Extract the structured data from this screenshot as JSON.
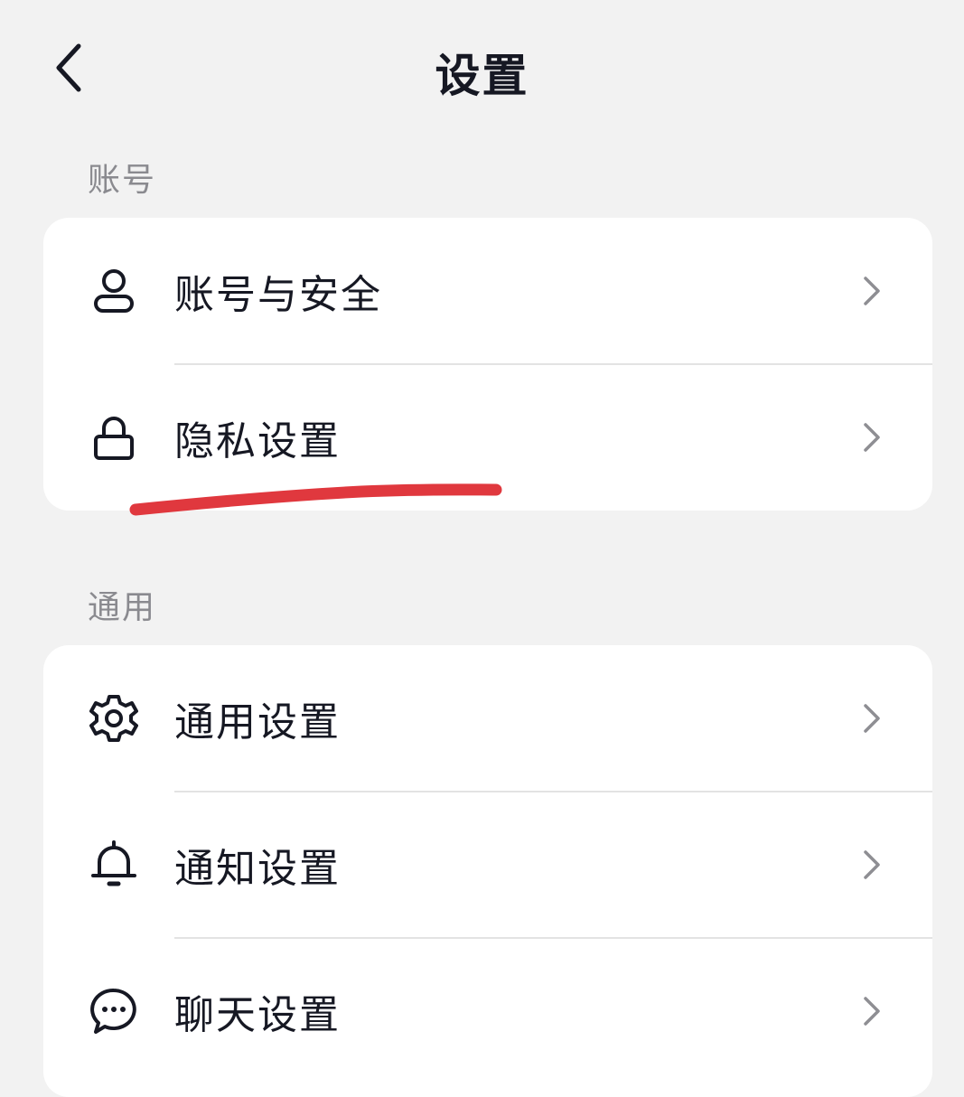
{
  "header": {
    "title": "设置"
  },
  "sections": [
    {
      "label": "账号",
      "items": [
        {
          "label": "账号与安全",
          "icon": "user-icon"
        },
        {
          "label": "隐私设置",
          "icon": "lock-icon"
        }
      ]
    },
    {
      "label": "通用",
      "items": [
        {
          "label": "通用设置",
          "icon": "gear-icon"
        },
        {
          "label": "通知设置",
          "icon": "bell-icon"
        },
        {
          "label": "聊天设置",
          "icon": "chat-bubble-icon"
        }
      ]
    }
  ],
  "colors": {
    "background": "#f2f2f2",
    "card": "#ffffff",
    "text": "#161823",
    "section_label": "#8a8a8f",
    "chevron": "#8e8e93",
    "annotation": "#e0383e"
  }
}
